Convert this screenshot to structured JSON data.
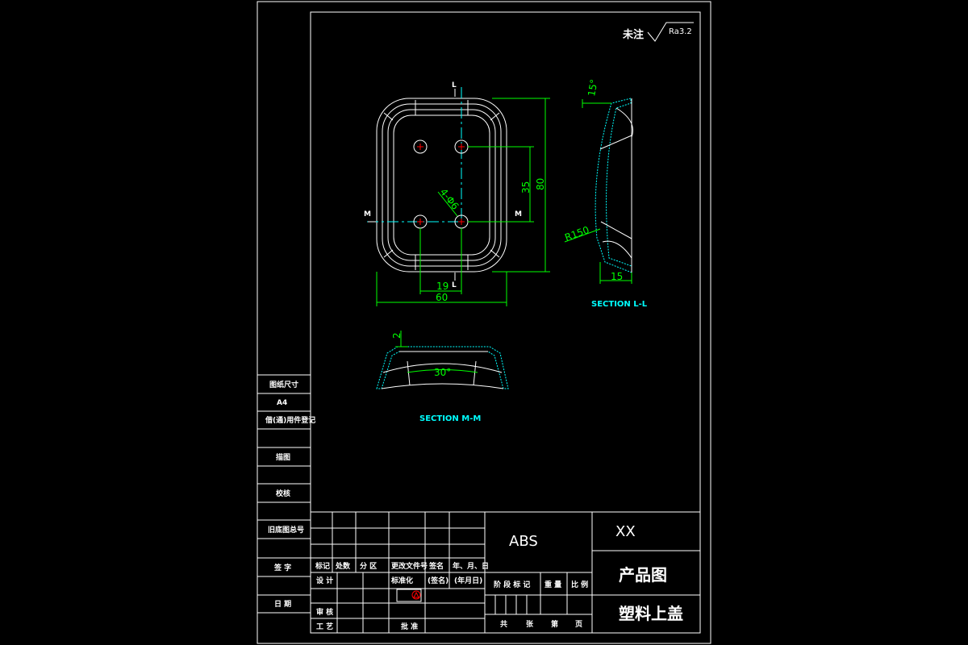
{
  "surface_note": {
    "label": "未注",
    "roughness": "Ra3.2"
  },
  "views": {
    "section_ll": "SECTION L-L",
    "section_mm": "SECTION M-M",
    "cut_label_l": "L",
    "cut_label_m": "M"
  },
  "dimensions": {
    "width_60": "60",
    "hole_spacing_19": "19",
    "hole_spacing_35": "35",
    "height_80": "80",
    "hole_dia": "4-Φ6",
    "angle_15": "15°",
    "radius_150": "R150",
    "depth_15": "15",
    "wall_2": "2",
    "angle_30": "30°"
  },
  "left_strip": {
    "rows": [
      "图纸尺寸",
      "A4",
      "借(通)用件登记",
      "",
      "描图",
      "",
      "校核",
      "",
      "旧底图总号",
      "",
      "签 字",
      "",
      "日 期",
      ""
    ]
  },
  "title_block": {
    "material": "ABS",
    "company": "XX",
    "drawing_type": "产品图",
    "part_name": "塑料上盖",
    "rev_headers": [
      "标记",
      "处数",
      "分 区",
      "更改文件号",
      "签名",
      "年、月、日"
    ],
    "row_design": "设 计",
    "row_standard": "标准化",
    "row_sign": "(签名)",
    "row_date": "(年月日)",
    "row_review": "审 核",
    "row_process": "工 艺",
    "row_approve": "批 准",
    "stage_headers": [
      "阶 段 标 记",
      "重 量",
      "比 例"
    ],
    "sheet_info": [
      "共",
      "张",
      "第",
      "页"
    ]
  }
}
